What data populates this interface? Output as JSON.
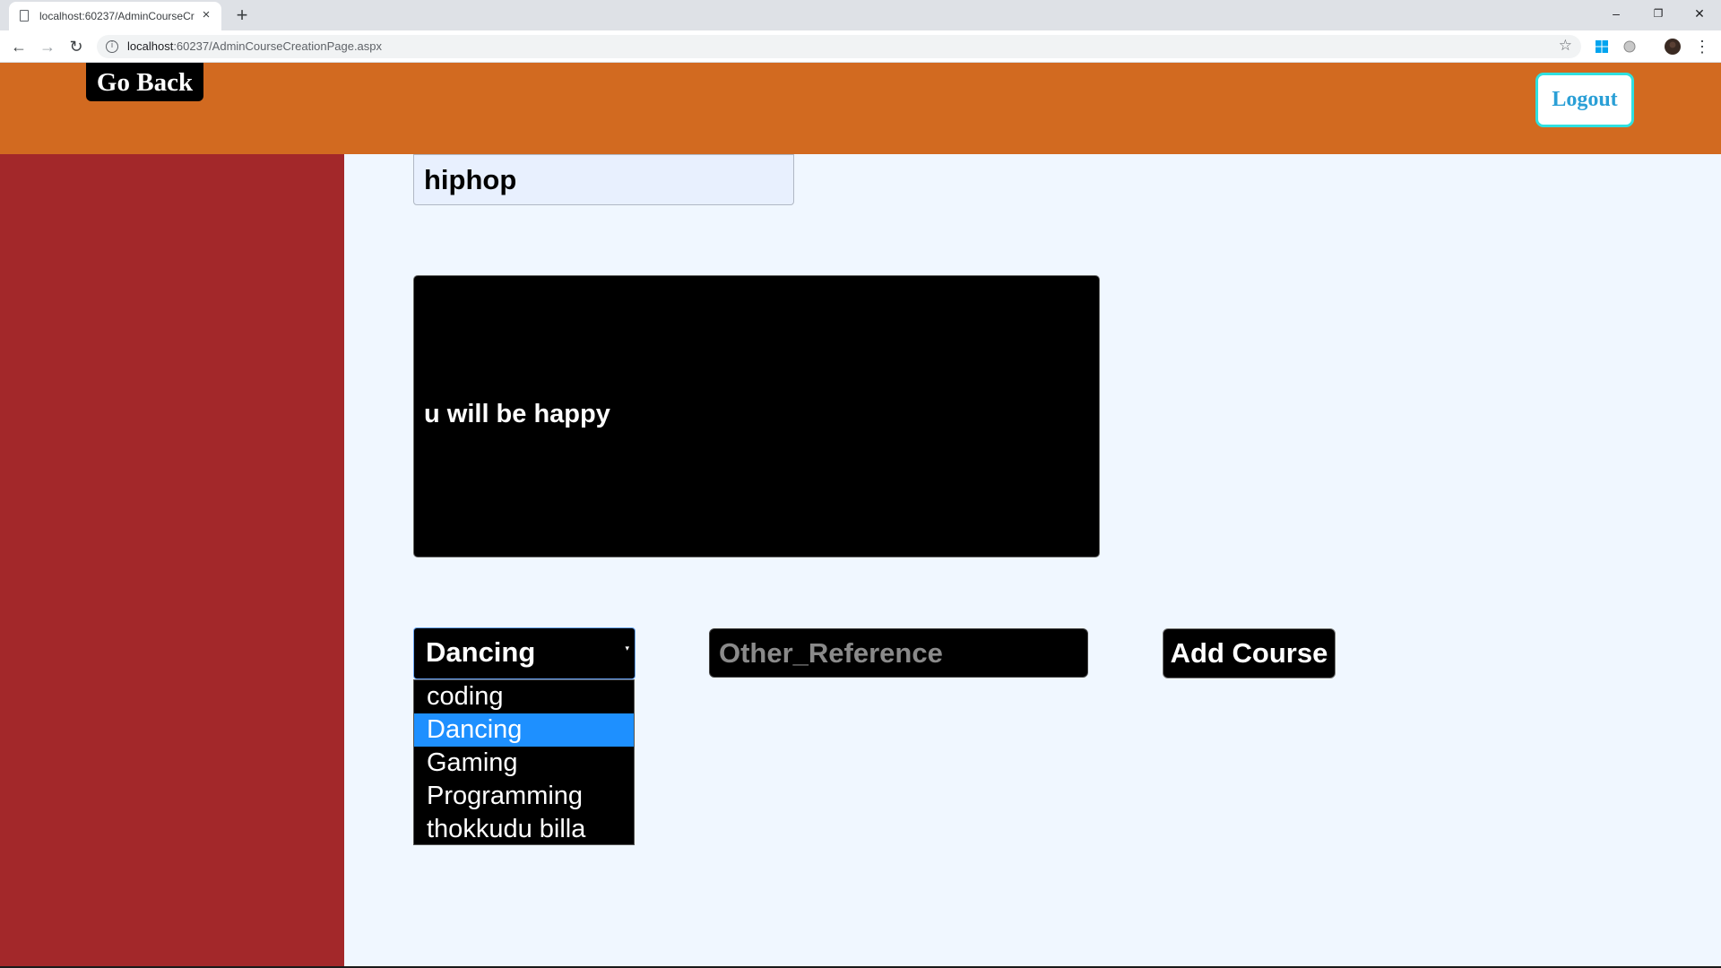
{
  "browser": {
    "tab_title": "localhost:60237/AdminCourseCr",
    "tab_close_glyph": "×",
    "new_tab_glyph": "+",
    "url_host": "localhost",
    "url_rest": ":60237/AdminCourseCreationPage.aspx",
    "window_controls": {
      "minimize": "–",
      "restore": "❐",
      "close": "✕"
    },
    "nav": {
      "back": "←",
      "forward": "→",
      "reload": "↻"
    },
    "info_glyph": "i",
    "star_glyph": "☆",
    "menu_glyph": "⋮"
  },
  "header": {
    "go_back_label": "Go Back",
    "logout_label": "Logout"
  },
  "form": {
    "course_name_value": "hiphop",
    "description_value": "u will be happy",
    "category": {
      "selected": "Dancing",
      "arrow_glyph": "▾",
      "options": [
        "coding",
        "Dancing",
        "Gaming",
        "Programming",
        "thokkudu billa"
      ]
    },
    "other_reference_placeholder": "Other_Reference",
    "add_course_label": "Add Course"
  },
  "colors": {
    "header": "#d26a20",
    "sidebar": "#a3282a",
    "main_bg": "#f0f7ff",
    "highlight": "#1e90ff",
    "logout_border": "#2fe0e0"
  }
}
